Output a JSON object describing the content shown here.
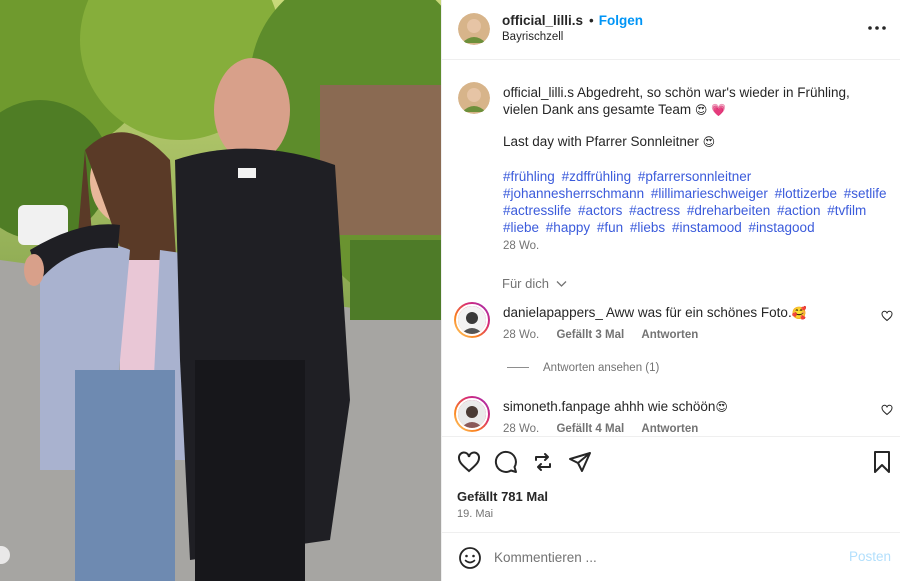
{
  "post": {
    "username": "official_lilli.s",
    "dot": "•",
    "follow_label": "Folgen",
    "location": "Bayrischzell",
    "more_icon": "more-horizontal-icon"
  },
  "caption": {
    "username": "official_lilli.s",
    "text": "Abgedreht, so schön war's wieder in Frühling, vielen Dank ans gesamte Team",
    "emoji": "😍 💗",
    "line2": "Last day with Pfarrer Sonnleitner",
    "line2_emoji": "😍",
    "hashtags": [
      "#frühling",
      "#zdffrühling",
      "#pfarrersonnleitner",
      "#johannesherrschmann",
      "#lillimarieschweiger",
      "#lottizerbe",
      "#setlife",
      "#actresslife",
      "#actors",
      "#actress",
      "#dreharbeiten",
      "#action",
      "#tvfilm",
      "#liebe",
      "#happy",
      "#fun",
      "#liebs",
      "#instamood",
      "#instagood"
    ],
    "time": "28 Wo."
  },
  "for_you_label": "Für dich",
  "comments": [
    {
      "username": "danielapappers_",
      "text": "Aww was für ein schönes Foto.",
      "emoji": "🥰",
      "time": "28 Wo.",
      "likes": "Gefällt 3 Mal",
      "reply_label": "Antworten"
    },
    {
      "username": "simoneth.fanpage",
      "text": "ahhh wie schöön",
      "emoji": "😍",
      "time": "28 Wo.",
      "likes": "Gefällt 4 Mal",
      "reply_label": "Antworten"
    }
  ],
  "view_replies_label": "Antworten ansehen (1)",
  "actions": {
    "likes": "Gefällt 781 Mal",
    "date": "19. Mai"
  },
  "comment_box": {
    "placeholder": "Kommentieren ...",
    "post_label": "Posten"
  },
  "colors": {
    "link_blue": "#0095f6",
    "hashtag_blue": "#3b5bdb",
    "muted": "#737373",
    "post_disabled": "#b2dffc"
  }
}
